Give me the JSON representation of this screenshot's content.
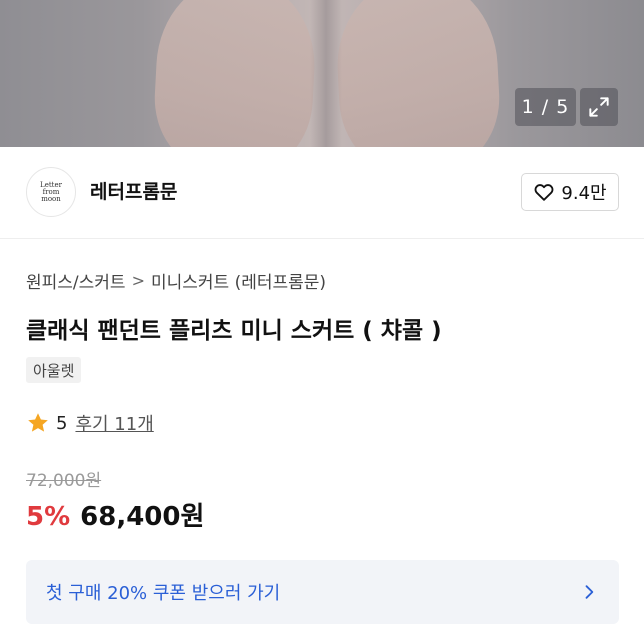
{
  "gallery": {
    "counter": "1 / 5"
  },
  "brand": {
    "logo_text": "Letter from moon",
    "name": "레터프롬문"
  },
  "like": {
    "count": "9.4만"
  },
  "breadcrumb": {
    "category": "원피스/스커트",
    "subcategory": "미니스커트 (레터프롬문)"
  },
  "product": {
    "title": "클래식 팬던트 플리츠 미니 스커트 ( 챠콜 )",
    "tag": "아울렛",
    "rating": "5",
    "reviews": "후기 11개",
    "original_price": "72,000원",
    "discount": "5%",
    "price": "68,400원"
  },
  "coupon": {
    "label": "첫 구매 20% 쿠폰 받으러 가기"
  },
  "colors": {
    "discount": "#e03a3e",
    "link": "#2a5fd6",
    "star": "#f5a623"
  }
}
